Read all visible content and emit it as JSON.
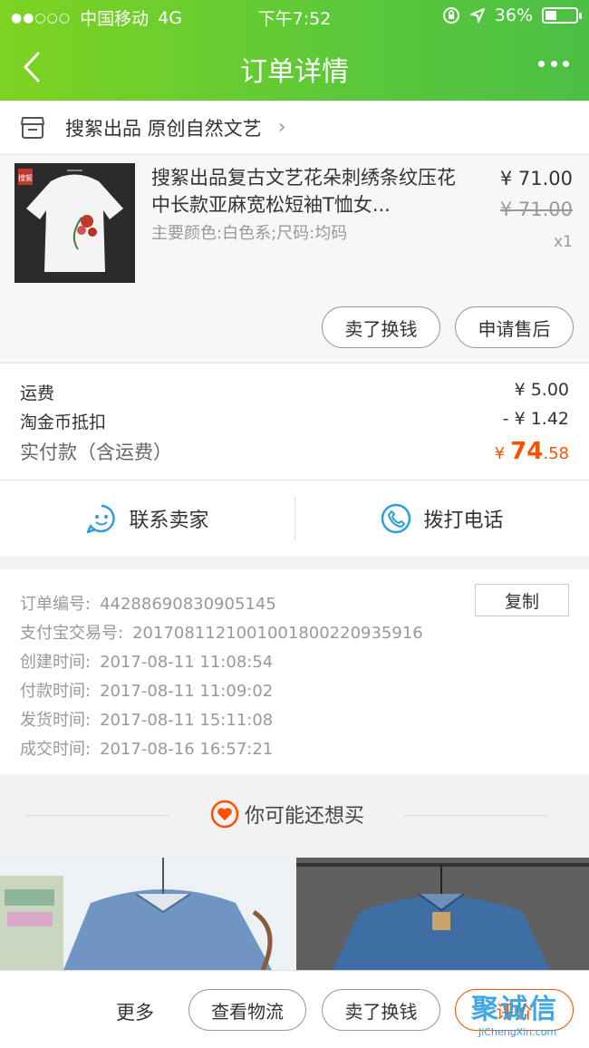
{
  "status_bar": {
    "carrier": "中国移动",
    "network": "4G",
    "time": "下午7:52",
    "battery_text": "36%",
    "battery_level": 0.36
  },
  "nav": {
    "title": "订单详情"
  },
  "shop": {
    "name": "搜絮出品 原创自然文艺"
  },
  "product": {
    "title": "搜絮出品复古文艺花朵刺绣条纹压花中长款亚麻宽松短袖T恤女...",
    "spec": "主要颜色:白色系;尺码:均码",
    "price": "¥ 71.00",
    "original_price": "¥ 71.00",
    "quantity": "x1",
    "thumb_stamp": "搜絮"
  },
  "product_actions": {
    "resell": "卖了换钱",
    "after_sale": "申请售后"
  },
  "fees": {
    "shipping_label": "运费",
    "shipping_value": "¥ 5.00",
    "coin_label": "淘金币抵扣",
    "coin_value": "- ¥ 1.42",
    "paid_label": "实付款（含运费）",
    "paid_currency": "¥",
    "paid_integer": "74",
    "paid_decimal": ".58"
  },
  "contact": {
    "seller": "联系卖家",
    "phone": "拨打电话"
  },
  "order_info": {
    "copy_label": "复制",
    "rows": [
      {
        "label": "订单编号:",
        "value": "44288690830905145"
      },
      {
        "label": "支付宝交易号:",
        "value": "2017081121001001800220935916"
      },
      {
        "label": "创建时间:",
        "value": "2017-08-11 11:08:54"
      },
      {
        "label": "付款时间:",
        "value": "2017-08-11 11:09:02"
      },
      {
        "label": "发货时间:",
        "value": "2017-08-11 15:11:08"
      },
      {
        "label": "成交时间:",
        "value": "2017-08-16 16:57:21"
      }
    ]
  },
  "recommend": {
    "title": "你可能还想买"
  },
  "bottom_bar": {
    "more": "更多",
    "logistics": "查看物流",
    "resell": "卖了换钱",
    "review": "评价"
  },
  "watermark": {
    "main": "聚诚信",
    "sub": "JiChengXin.com"
  },
  "colors": {
    "header_green": "#5bc83a",
    "accent_orange": "#ff5000",
    "icon_blue": "#2d9de0"
  }
}
